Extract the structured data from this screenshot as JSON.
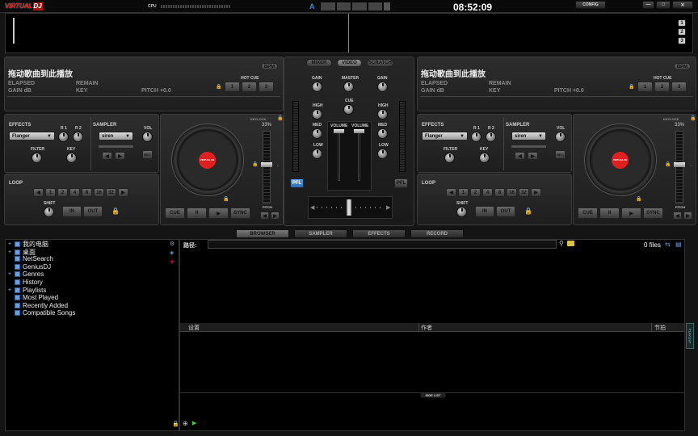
{
  "topbar": {
    "logo_a": "VIRTUAL",
    "logo_b": "DJ",
    "cpu": "CPU",
    "clock": "08:52:09",
    "config": "CONFIG",
    "deck_sel": "A"
  },
  "waveform": {
    "layers": [
      "1",
      "2",
      "3"
    ]
  },
  "decks": [
    {
      "title": "拖动歌曲到此播放",
      "bpm_btn": "BPM",
      "elapsed": "ELAPSED",
      "remain": "REMAIN",
      "gain": "GAIN dB",
      "key": "KEY",
      "pitch": "PITCH +0.0",
      "hotcue": "HOT CUE",
      "hotcues": [
        "1",
        "2",
        "3"
      ],
      "effects": "EFFECTS",
      "effect_val": "Flanger",
      "r1": "R 1",
      "r2": "R 2",
      "filter": "FILTER",
      "key_knob": "KEY",
      "sampler": "SAMPLER",
      "sample_val": "siren",
      "vol": "VOL",
      "rec": "REC",
      "loop": "LOOP",
      "loops": [
        "1",
        "2",
        "4",
        "8",
        "16",
        "32"
      ],
      "shift": "SHIFT",
      "in": "IN",
      "out": "OUT",
      "keylock": "KEYLOCK",
      "pitch_pct": "33%",
      "pitch_lbl": "PITCH",
      "cue": "CUE",
      "play": "II",
      "play2": "▶",
      "sync": "SYNC",
      "platter": "VIRTUAL DJ"
    },
    {
      "title": "拖动歌曲到此播放",
      "bpm_btn": "BPM",
      "elapsed": "ELAPSED",
      "remain": "REMAIN",
      "gain": "GAIN dB",
      "key": "KEY",
      "pitch": "PITCH +0.0",
      "hotcue": "HOT CUE",
      "hotcues": [
        "1",
        "2",
        "3"
      ],
      "effects": "EFFECTS",
      "effect_val": "Flanger",
      "r1": "R 1",
      "r2": "R 2",
      "filter": "FILTER",
      "key_knob": "KEY",
      "sampler": "SAMPLER",
      "sample_val": "siren",
      "vol": "VOL",
      "rec": "REC",
      "loop": "LOOP",
      "loops": [
        "1",
        "2",
        "4",
        "8",
        "16",
        "32"
      ],
      "shift": "SHIFT",
      "in": "IN",
      "out": "OUT",
      "keylock": "KEYLOCK",
      "pitch_pct": "33%",
      "pitch_lbl": "PITCH",
      "cue": "CUE",
      "play": "II",
      "play2": "▶",
      "sync": "SYNC",
      "platter": "VIRTUAL DJ"
    }
  ],
  "mixer": {
    "tabs": [
      "MIXER",
      "VIDEO",
      "SCRATCH"
    ],
    "gain": "GAIN",
    "master": "MASTER",
    "cue": "CUE",
    "high": "HIGH",
    "med": "MED",
    "low": "LOW",
    "volume": "VOLUME",
    "pfl": "PFL"
  },
  "browser": {
    "tabs": [
      "BROWSER",
      "SAMPLER",
      "EFFECTS",
      "RECORD"
    ],
    "path_label": "路径:",
    "files": "0 files",
    "columns": [
      "设置",
      "作者",
      "节拍"
    ],
    "side_list": "SIDE LIST",
    "playlist_tab": "PLAYLIST",
    "tree": [
      {
        "label": "我的电脑",
        "exp": "+"
      },
      {
        "label": "桌面",
        "exp": "+"
      },
      {
        "label": "NetSearch",
        "exp": ""
      },
      {
        "label": "GeniusDJ",
        "exp": ""
      },
      {
        "label": "Genres",
        "exp": "+"
      },
      {
        "label": "History",
        "exp": ""
      },
      {
        "label": "Playlists",
        "exp": "+"
      },
      {
        "label": "Most Played",
        "exp": ""
      },
      {
        "label": "Recently Added",
        "exp": ""
      },
      {
        "label": "Compatible Songs",
        "exp": ""
      }
    ]
  },
  "colors": {
    "accent": "#3c8ad8",
    "cue_lock": "#e08a1e",
    "platter_red": "#e02020"
  }
}
